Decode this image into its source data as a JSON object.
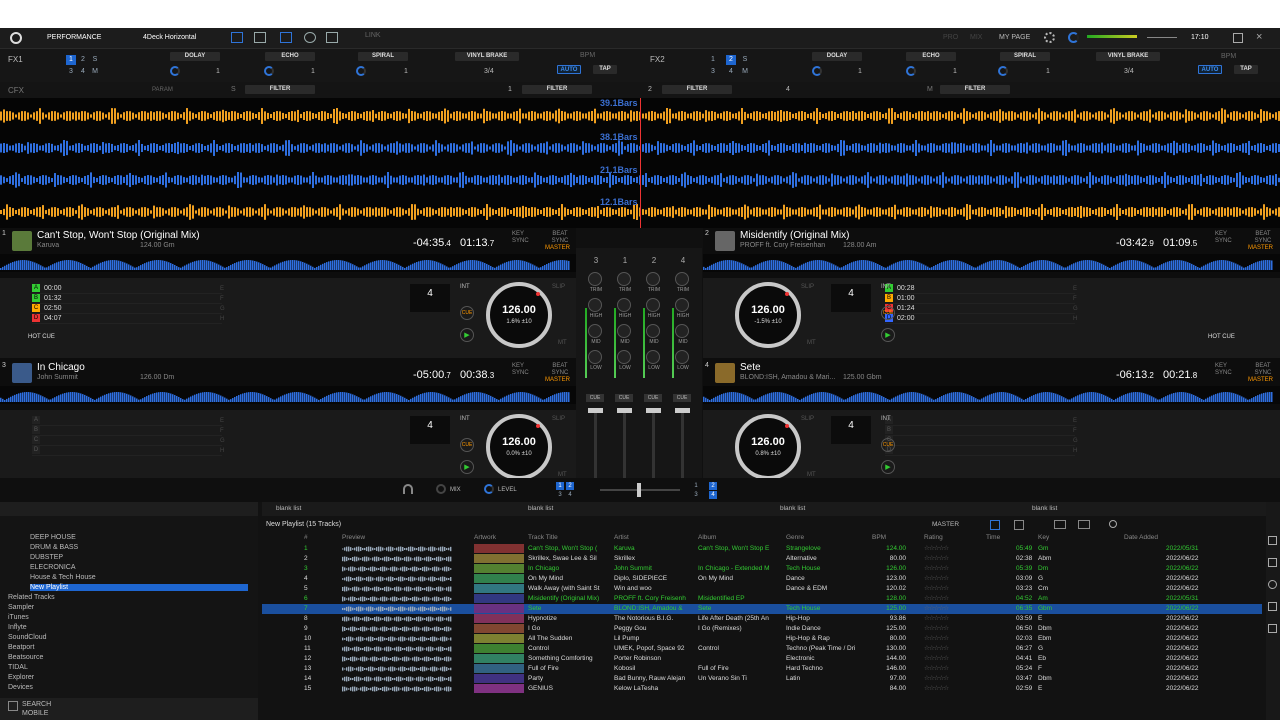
{
  "top": {
    "mode": "PERFORMANCE",
    "layout": "4Deck Horizontal",
    "link": "LINK",
    "mypage": "MY PAGE",
    "time": "17:10",
    "pro": "PRO",
    "mix": "MIX"
  },
  "fx": [
    {
      "label": "FX1",
      "bank": [
        "1",
        "2",
        "S",
        "3",
        "4",
        "M"
      ],
      "slots": [
        "DOLAY",
        "ECHO",
        "SPIRAL"
      ],
      "vals": [
        "1",
        "1",
        "1"
      ],
      "brake": "VINYL BRAKE",
      "beat": "3/4",
      "bpm": "BPM",
      "auto": "AUTO",
      "tap": "TAP"
    },
    {
      "label": "FX2",
      "bank": [
        "1",
        "2",
        "S",
        "3",
        "4",
        "M"
      ],
      "slots": [
        "DOLAY",
        "ECHO",
        "SPIRAL"
      ],
      "vals": [
        "1",
        "1",
        "1"
      ],
      "brake": "VINYL BRAKE",
      "beat": "3/4",
      "bpm": "BPM",
      "auto": "AUTO",
      "tap": "TAP"
    }
  ],
  "cfx": {
    "label": "CFX",
    "param": "PARAM",
    "s": "S",
    "filters": [
      "FILTER",
      "FILTER",
      "FILTER",
      "FILTER"
    ],
    "nums": [
      "1",
      "2",
      "4"
    ],
    "m": "M"
  },
  "waveforms": [
    {
      "bars": "39.1Bars",
      "color": "#f0a020"
    },
    {
      "bars": "38.1Bars",
      "color": "#2f6fe0"
    },
    {
      "bars": "21.1Bars",
      "color": "#2f6fe0"
    },
    {
      "bars": "12.1Bars",
      "color": "#f0a020"
    }
  ],
  "decks": [
    {
      "num": "1",
      "title": "Can't Stop, Won't Stop (Original Mix)",
      "artist": "Karuva",
      "bpmkey": "124.00  Gm",
      "remain": "-04:35",
      "remainsub": ".4",
      "elapsed": "01:13",
      "elapsedsub": ".7",
      "keylabel": "KEY",
      "sync": "SYNC",
      "beatsync": "BEAT SYNC",
      "master": "MASTER",
      "hotcues": [
        [
          "A",
          "00:00",
          "#3c3"
        ],
        [
          "B",
          "01:32",
          "#3c3"
        ],
        [
          "C",
          "02:50",
          "#fa0"
        ],
        [
          "D",
          "04:07",
          "#e33"
        ]
      ],
      "hclabels": [
        "E",
        "F",
        "G",
        "H"
      ],
      "beat": "4",
      "bpm": "126.00",
      "pct": "1.6%  ±10",
      "hotcue": "HOT CUE",
      "int": "INT",
      "slip": "SLIP",
      "mt": "MT",
      "cue": "CUE",
      "art": "#5a7a3a"
    },
    {
      "num": "2",
      "title": "Misidentify (Original Mix)",
      "artist": "PROFF ft. Cory Freisenhan",
      "bpmkey": "128.00  Am",
      "remain": "-03:42",
      "remainsub": ".9",
      "elapsed": "01:09",
      "elapsedsub": ".5",
      "keylabel": "KEY",
      "sync": "SYNC",
      "beatsync": "BEAT SYNC",
      "master": "MASTER",
      "hotcues": [
        [
          "A",
          "00:28",
          "#3c3"
        ],
        [
          "B",
          "01:00",
          "#fa0"
        ],
        [
          "C",
          "01:24",
          "#e33"
        ],
        [
          "D",
          "02:00",
          "#36f"
        ]
      ],
      "hclabels": [
        "E",
        "F",
        "G",
        "H"
      ],
      "beat": "4",
      "bpm": "126.00",
      "pct": "-1.5%  ±10",
      "hotcue": "HOT CUE",
      "int": "INT",
      "slip": "SLIP",
      "mt": "MT",
      "cue": "CUE",
      "art": "#666"
    },
    {
      "num": "3",
      "title": "In Chicago",
      "artist": "John Summit",
      "bpmkey": "126.00  Dm",
      "remain": "-05:00",
      "remainsub": ".7",
      "elapsed": "00:38",
      "elapsedsub": ".3",
      "keylabel": "KEY",
      "sync": "SYNC",
      "beatsync": "BEAT SYNC",
      "master": "MASTER",
      "hotcues": [
        [
          "A",
          "",
          ""
        ],
        [
          "B",
          "",
          ""
        ],
        [
          "C",
          "",
          ""
        ],
        [
          "D",
          "",
          ""
        ]
      ],
      "hclabels": [
        "E",
        "F",
        "G",
        "H"
      ],
      "beat": "4",
      "bpm": "126.00",
      "pct": "0.0%  ±10",
      "hotcue": "HOT CUE",
      "int": "INT",
      "slip": "SLIP",
      "mt": "MT",
      "cue": "CUE",
      "art": "#3a5a8a"
    },
    {
      "num": "4",
      "title": "Sete",
      "artist": "BLOND:ISH, Amadou & Mari...",
      "bpmkey": "125.00  Gbm",
      "remain": "-06:13",
      "remainsub": ".2",
      "elapsed": "00:21",
      "elapsedsub": ".8",
      "keylabel": "KEY",
      "sync": "SYNC",
      "beatsync": "BEAT SYNC",
      "master": "MASTER",
      "hotcues": [
        [
          "A",
          "",
          ""
        ],
        [
          "B",
          "",
          ""
        ],
        [
          "C",
          "",
          ""
        ],
        [
          "D",
          "",
          ""
        ]
      ],
      "hclabels": [
        "E",
        "F",
        "G",
        "H"
      ],
      "beat": "4",
      "bpm": "126.00",
      "pct": "0.8%  ±10",
      "hotcue": "HOT CUE",
      "int": "INT",
      "slip": "SLIP",
      "mt": "MT",
      "cue": "CUE",
      "art": "#8a6a2a"
    }
  ],
  "mixer": {
    "channels": [
      "3",
      "1",
      "2",
      "4"
    ],
    "trim": "TRIM",
    "high": "HIGH",
    "mid": "MID",
    "low": "LOW",
    "cue": "CUE"
  },
  "bottombar": {
    "mix": "MIX",
    "level": "LEVEL",
    "left": [
      "1",
      "2",
      "3",
      "4"
    ],
    "right": [
      "1",
      "2",
      "3",
      "4"
    ]
  },
  "tree": {
    "items": [
      "DEEP HOUSE",
      "DRUM & BASS",
      "DUBSTEP",
      "ELECRONICA",
      "House & Tech House",
      "New Playlist",
      "Related Tracks",
      "Sampler",
      "iTunes",
      "Inflyte",
      "SoundCloud",
      "Beatport",
      "Beatsource",
      "TIDAL",
      "Explorer",
      "Devices"
    ],
    "search": "SEARCH",
    "mobile": "MOBILE"
  },
  "lists": [
    "blank list",
    "blank list",
    "blank list",
    "blank list"
  ],
  "playlist": {
    "title": "New Playlist (15 Tracks)",
    "master": "MASTER",
    "columns": [
      "#",
      "Preview",
      "Artwork",
      "Track Title",
      "Artist",
      "Album",
      "Genre",
      "BPM",
      "Rating",
      "Time",
      "Key",
      "Date Added"
    ]
  },
  "tracks": [
    [
      "1",
      "Can't Stop, Won't Stop (",
      "Karuva",
      "Can't Stop, Won't Stop E",
      "Strangelove",
      "124.00",
      "05:49",
      "Gm",
      "2022/05/31",
      "#3c3"
    ],
    [
      "2",
      "Skrillex, Swae Lee & Sil",
      "Skrillex",
      "",
      "Alternative",
      "80.00",
      "02:38",
      "Abm",
      "2022/06/22",
      "#ddd"
    ],
    [
      "3",
      "In Chicago",
      "John Summit",
      "In Chicago - Extended M",
      "Tech House",
      "126.00",
      "05:39",
      "Dm",
      "2022/06/22",
      "#3c3"
    ],
    [
      "4",
      "On My Mind",
      "Diplo, SIDEPIECE",
      "On My Mind",
      "Dance",
      "123.00",
      "03:09",
      "G",
      "2022/06/22",
      "#ddd"
    ],
    [
      "5",
      "Walk Away (with Saint St",
      "Win and woo",
      "",
      "Dance & EDM",
      "120.02",
      "03:23",
      "Cm",
      "2022/06/22",
      "#ddd"
    ],
    [
      "6",
      "Misidentify (Original Mix)",
      "PROFF ft. Cory Freisenh",
      "Misidentified EP",
      "",
      "128.00",
      "04:52",
      "Am",
      "2022/05/31",
      "#3c3"
    ],
    [
      "7",
      "Sete",
      "BLOND:ISH, Amadou &",
      "Sete",
      "Tech House",
      "125.00",
      "06:35",
      "Gbm",
      "2022/06/22",
      "#3c3"
    ],
    [
      "8",
      "Hypnotize",
      "The Notorious B.I.G.",
      "Life After Death (25th An",
      "Hip-Hop",
      "93.86",
      "03:59",
      "E",
      "2022/06/22",
      "#ddd"
    ],
    [
      "9",
      "I Go",
      "Peggy Gou",
      "I Go (Remixes)",
      "Indie Dance",
      "125.00",
      "06:50",
      "Dbm",
      "2022/06/22",
      "#ddd"
    ],
    [
      "10",
      "All The Sudden",
      "Lil Pump",
      "",
      "Hip-Hop & Rap",
      "80.00",
      "02:03",
      "Ebm",
      "2022/06/22",
      "#ddd"
    ],
    [
      "11",
      "Control",
      "UMEK, Popof, Space 92",
      "Control",
      "Techno (Peak Time / Dri",
      "130.00",
      "06:27",
      "G",
      "2022/06/22",
      "#ddd"
    ],
    [
      "12",
      "Something Comforting",
      "Porter Robinson",
      "",
      "Electronic",
      "144.00",
      "04:41",
      "Eb",
      "2022/06/22",
      "#ddd"
    ],
    [
      "13",
      "Full of Fire",
      "Kobosil",
      "Full of Fire",
      "Hard Techno",
      "146.00",
      "05:24",
      "F",
      "2022/06/22",
      "#ddd"
    ],
    [
      "14",
      "Party",
      "Bad Bunny, Rauw Alejan",
      "Un Verano Sin Ti",
      "Latin",
      "97.00",
      "03:47",
      "Dbm",
      "2022/06/22",
      "#ddd"
    ],
    [
      "15",
      "GENIUS",
      "Kelow LaTesha",
      "",
      "",
      "84.00",
      "02:59",
      "E",
      "2022/06/22",
      "#ddd"
    ]
  ]
}
